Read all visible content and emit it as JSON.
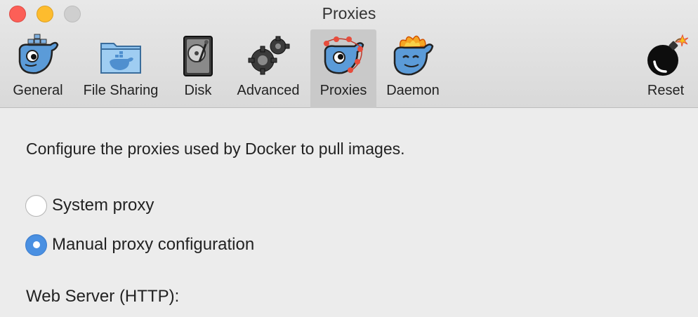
{
  "window": {
    "title": "Proxies"
  },
  "tabs": [
    {
      "label": "General",
      "icon": "whale-icon"
    },
    {
      "label": "File Sharing",
      "icon": "folder-whale-icon"
    },
    {
      "label": "Disk",
      "icon": "hard-disk-icon"
    },
    {
      "label": "Advanced",
      "icon": "gears-icon"
    },
    {
      "label": "Proxies",
      "icon": "whale-network-icon",
      "active": true
    },
    {
      "label": "Daemon",
      "icon": "whale-fire-icon"
    },
    {
      "label": "Reset",
      "icon": "bomb-icon"
    }
  ],
  "proxies": {
    "description": "Configure the proxies used by Docker to pull images.",
    "options": [
      {
        "label": "System proxy",
        "selected": false
      },
      {
        "label": "Manual proxy configuration",
        "selected": true
      }
    ],
    "web_server_label": "Web Server (HTTP):"
  },
  "colors": {
    "accent": "#4a90e2",
    "close": "#fc5f57",
    "minimize": "#fdbc2e",
    "whale": "#5b9bd8"
  }
}
